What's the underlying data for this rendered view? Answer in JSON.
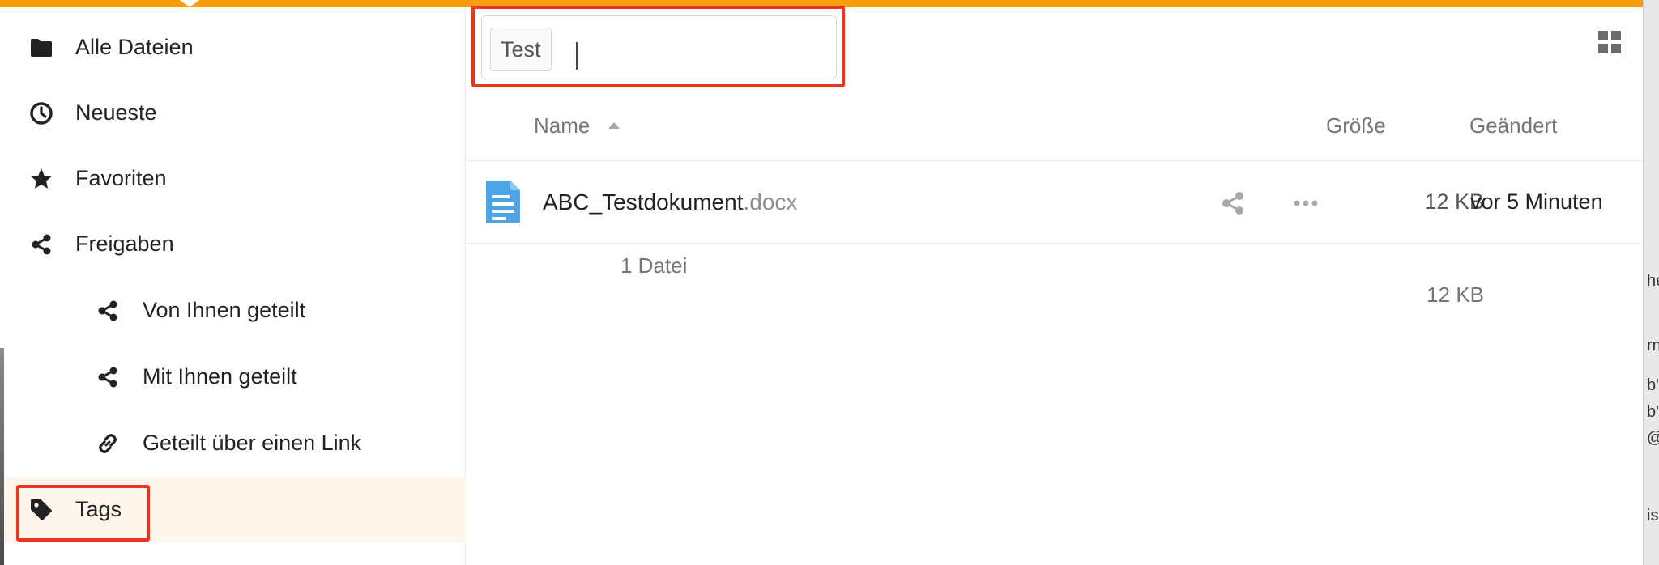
{
  "sidebar": {
    "items": [
      {
        "label": "Alle Dateien",
        "icon": "folder-icon"
      },
      {
        "label": "Neueste",
        "icon": "clock-icon"
      },
      {
        "label": "Favoriten",
        "icon": "star-icon"
      },
      {
        "label": "Freigaben",
        "icon": "share-icon"
      },
      {
        "label": "Von Ihnen geteilt",
        "icon": "share-icon"
      },
      {
        "label": "Mit Ihnen geteilt",
        "icon": "share-icon"
      },
      {
        "label": "Geteilt über einen Link",
        "icon": "link-icon"
      },
      {
        "label": "Tags",
        "icon": "tag-icon",
        "active": true
      }
    ]
  },
  "filter": {
    "tag": "Test",
    "input_value": "",
    "input_placeholder": ""
  },
  "table": {
    "columns": {
      "name": "Name",
      "size": "Größe",
      "modified": "Geändert"
    },
    "rows": [
      {
        "name": "ABC_Testdokument",
        "extension": ".docx",
        "size": "12 KB",
        "modified": "vor 5 Minuten",
        "icon": "document-icon"
      }
    ],
    "summary": {
      "count": "1 Datei",
      "total_size": "12 KB"
    }
  },
  "background_fragments": [
    "he",
    "rn",
    "b'",
    "b'",
    "@",
    "is"
  ],
  "colors": {
    "accent": "#f59d0c",
    "highlight": "#e8371e",
    "active_bg": "#fef6ea",
    "file_icon": "#4aa4e6"
  }
}
